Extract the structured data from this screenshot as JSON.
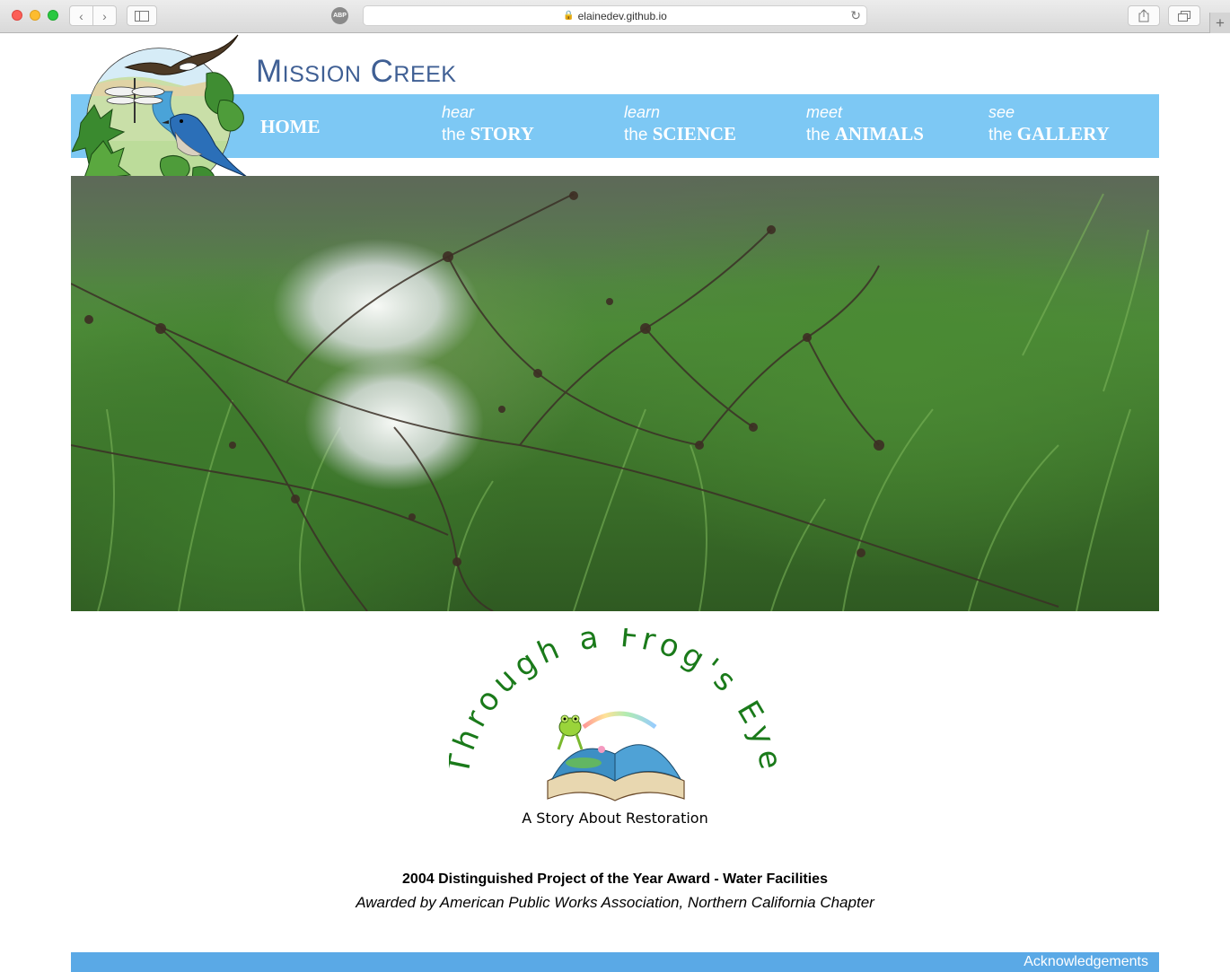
{
  "browser": {
    "url": "elainedev.github.io",
    "adblock_label": "ABP"
  },
  "site": {
    "title": "Mission Creek"
  },
  "nav": {
    "home": "HOME",
    "items": [
      {
        "top": "hear",
        "prefix": "the",
        "label": "STORY"
      },
      {
        "top": "learn",
        "prefix": "the",
        "label": "SCIENCE"
      },
      {
        "top": "meet",
        "prefix": "the",
        "label": "ANIMALS"
      },
      {
        "top": "see",
        "prefix": "the",
        "label": "GALLERY"
      }
    ]
  },
  "book": {
    "arc_title": "Through a Frog's Eye",
    "subtitle": "A Story About Restoration"
  },
  "award": {
    "title": "2004 Distinguished Project of the Year Award - Water Facilities",
    "subtitle": "Awarded by American Public Works Association, Northern California Chapter"
  },
  "footer": {
    "link": "Acknowledgements"
  },
  "colors": {
    "nav_bg": "#7dc8f4",
    "footer_bg": "#5aa9e6",
    "title": "#3f5f94",
    "frog_text": "#1a7a1a"
  }
}
